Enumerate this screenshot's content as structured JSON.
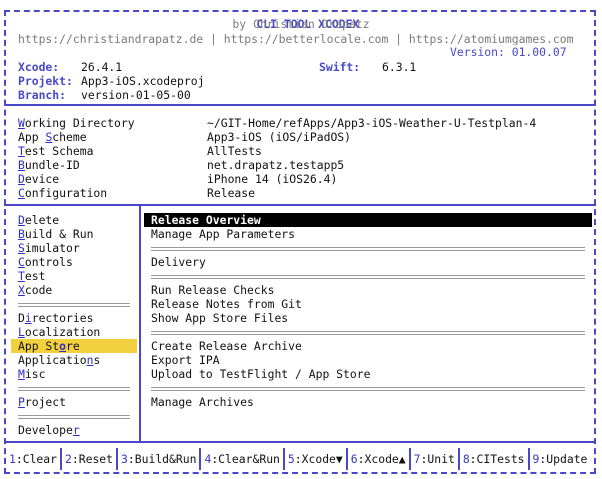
{
  "header": {
    "title": "CLI TOOL XCODEX",
    "author": "by Christian Drapatz",
    "links": "https://christiandrapatz.de | https://betterlocale.com | https://atomiumgames.com",
    "version": "Version: 01.00.07"
  },
  "info": {
    "xcode_label": "Xcode:",
    "xcode_value": "26.4.1",
    "swift_label": "Swift:",
    "swift_value": "6.3.1",
    "projekt_label": "Projekt:",
    "projekt_value": "App3-iOS.xcodeproj",
    "branch_label": "Branch:",
    "branch_value": "version-01-05-00"
  },
  "config": [
    {
      "hot": "W",
      "rest": "orking Directory",
      "value": "~/GIT-Home/refApps/App3-iOS-Weather-U-Testplan-4"
    },
    {
      "pre": "App ",
      "hot": "S",
      "rest": "cheme",
      "value": "App3-iOS (iOS/iPadOS)"
    },
    {
      "hot": "T",
      "rest": "est Schema",
      "value": "AllTests"
    },
    {
      "hot": "B",
      "rest": "undle-ID",
      "value": "net.drapatz.testapp5"
    },
    {
      "hot": "D",
      "rest": "evice",
      "value": "iPhone 14 (iOS26.4)"
    },
    {
      "hot": "C",
      "rest": "onfiguration",
      "value": "Release"
    }
  ],
  "menu": [
    {
      "pre": "",
      "hot": "D",
      "rest": "elete"
    },
    {
      "pre": "",
      "hot": "B",
      "rest": "uild & Run"
    },
    {
      "pre": "",
      "hot": "S",
      "rest": "imulator"
    },
    {
      "pre": "",
      "hot": "C",
      "rest": "ontrols"
    },
    {
      "pre": "",
      "hot": "T",
      "rest": "est"
    },
    {
      "pre": "",
      "hot": "X",
      "rest": "code"
    },
    {
      "pre": "D",
      "hot": "i",
      "rest": "rectories"
    },
    {
      "pre": "",
      "hot": "L",
      "rest": "ocalization"
    },
    {
      "pre": "App St",
      "hot": "o",
      "rest": "re"
    },
    {
      "pre": "Applicatio",
      "hot": "n",
      "rest": "s"
    },
    {
      "pre": "",
      "hot": "M",
      "rest": "isc"
    },
    {
      "pre": "",
      "hot": "P",
      "rest": "roject"
    },
    {
      "pre": "Develope",
      "hot": "r",
      "rest": ""
    }
  ],
  "submenu": [
    "Release Overview",
    "Manage App Parameters",
    "Delivery",
    "Run Release Checks",
    "Release Notes from Git",
    "Show App Store Files",
    "Create Release Archive",
    "Export IPA",
    "Upload to TestFlight / App Store",
    "Manage Archives"
  ],
  "footer": [
    {
      "n": "1",
      "label": ":Clear"
    },
    {
      "n": "2",
      "label": ":Reset"
    },
    {
      "n": "3",
      "label": ":Build&Run"
    },
    {
      "n": "4",
      "label": ":Clear&Run"
    },
    {
      "n": "5",
      "label": ":Xcode▼"
    },
    {
      "n": "6",
      "label": ":Xcode▲"
    },
    {
      "n": "7",
      "label": ":Unit"
    },
    {
      "n": "8",
      "label": ":CITests"
    },
    {
      "n": "9",
      "label": ":Update"
    }
  ],
  "colors": {
    "accent": "#4848c8",
    "selection": "#f3d13e",
    "highlight_bg": "#000000"
  }
}
